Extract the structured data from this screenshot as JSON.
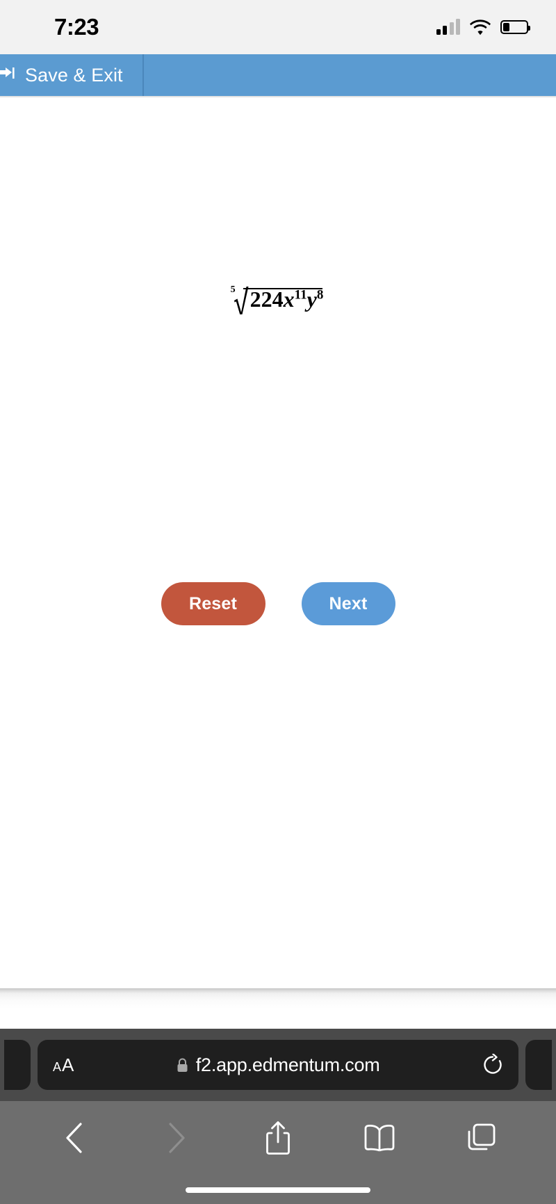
{
  "status_bar": {
    "time": "7:23",
    "signal_icon": "cellular-signal-icon",
    "wifi_icon": "wifi-icon",
    "battery_icon": "battery-low-icon"
  },
  "app_header": {
    "save_exit_label": "Save & Exit",
    "save_exit_icon": "exit-arrow-icon",
    "background_color": "#5b9bd1"
  },
  "content": {
    "expression": {
      "radical_index": "5",
      "coefficient": "224",
      "term1_base": "x",
      "term1_exponent": "11",
      "term2_base": "y",
      "term2_exponent": "8",
      "plain_text": "⁵√(224x¹¹y⁸)"
    },
    "buttons": {
      "reset_label": "Reset",
      "reset_color": "#c2563d",
      "next_label": "Next",
      "next_color": "#5b9bd8"
    }
  },
  "browser": {
    "text_size_button": {
      "small": "A",
      "big": "A"
    },
    "lock_icon": "lock-icon",
    "url": "f2.app.edmentum.com",
    "reload_icon": "reload-icon",
    "toolbar": [
      {
        "name": "back",
        "icon": "chevron-left-icon",
        "enabled": true
      },
      {
        "name": "forward",
        "icon": "chevron-right-icon",
        "enabled": false
      },
      {
        "name": "share",
        "icon": "share-icon",
        "enabled": true
      },
      {
        "name": "bookmarks",
        "icon": "book-icon",
        "enabled": true
      },
      {
        "name": "tabs",
        "icon": "tabs-icon",
        "enabled": true
      }
    ]
  }
}
